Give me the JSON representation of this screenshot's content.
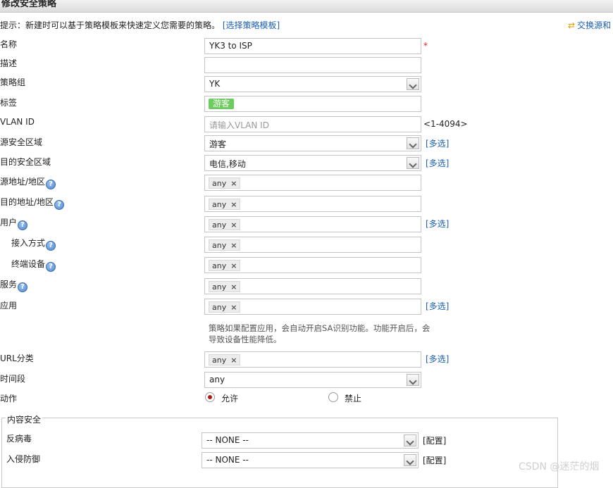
{
  "window": {
    "title": "修改安全策略"
  },
  "hint": {
    "text": "提示：新建时可以基于策略模板来快速定义您需要的策略。",
    "template_link": "[选择策略模板]"
  },
  "swap_link": "交换源和",
  "fields": {
    "name": {
      "label": "名称",
      "value": "YK3 to ISP",
      "required": "*"
    },
    "description": {
      "label": "描述",
      "value": ""
    },
    "group": {
      "label": "策略组",
      "value": "YK"
    },
    "tag": {
      "label": "标签",
      "value": "游客"
    },
    "vlan": {
      "label": "VLAN ID",
      "placeholder": "请输入VLAN ID",
      "range": "<1-4094>"
    },
    "src_zone": {
      "label": "源安全区域",
      "value": "游客",
      "multi": "[多选]"
    },
    "dst_zone": {
      "label": "目的安全区域",
      "value": "电信,移动",
      "multi": "[多选]"
    },
    "src_addr": {
      "label": "源地址/地区",
      "chip": "any"
    },
    "dst_addr": {
      "label": "目的地址/地区",
      "chip": "any"
    },
    "user": {
      "label": "用户",
      "chip": "any",
      "multi": "[多选]"
    },
    "access": {
      "label": "接入方式",
      "chip": "any"
    },
    "terminal": {
      "label": "终端设备",
      "chip": "any"
    },
    "service": {
      "label": "服务",
      "chip": "any"
    },
    "app": {
      "label": "应用",
      "chip": "any",
      "multi": "[多选]",
      "note": "策略如果配置应用，会自动开启SA识别功能。功能开启后，会导致设备性能降低。"
    },
    "url": {
      "label": "URL分类",
      "chip": "any",
      "multi": "[多选]"
    },
    "time": {
      "label": "时间段",
      "value": "any"
    },
    "action": {
      "label": "动作",
      "allow": "允许",
      "deny": "禁止",
      "selected": "allow"
    }
  },
  "content_security": {
    "legend": "内容安全",
    "antivirus": {
      "label": "反病毒",
      "value": "-- NONE --",
      "config": "[配置]"
    },
    "ips": {
      "label": "入侵防御",
      "value": "-- NONE --",
      "config": "[配置]"
    }
  },
  "watermark": "CSDN @迷茫的烟"
}
